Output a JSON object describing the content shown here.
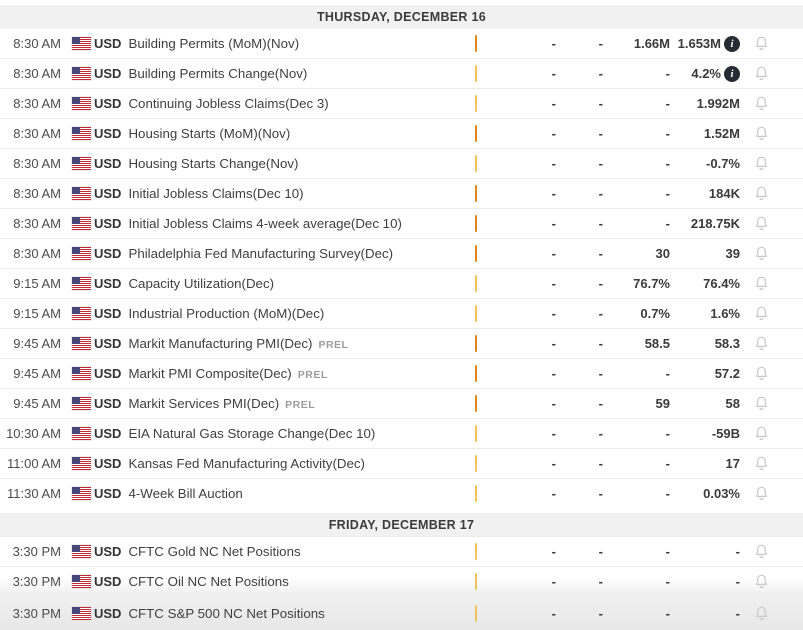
{
  "theme": {
    "impact_medium_color": "#E0861E",
    "impact_low_color": "#F5C963",
    "section_header_bg": "#F1F1F2",
    "info_icon_bg": "#272B33",
    "bell_icon_color": "#CBCBCB"
  },
  "columns": [
    "time",
    "currency",
    "event",
    "impact",
    "actual",
    "deviation",
    "consensus",
    "previous"
  ],
  "sections": [
    {
      "title": "THURSDAY, DECEMBER 16",
      "rows": [
        {
          "time": "8:30 AM",
          "currency": "USD",
          "flag": "us-flag",
          "event": "Building Permits (MoM)(Nov)",
          "suffix": "",
          "impact": "medium",
          "actual": "-",
          "deviation": "-",
          "consensus": "1.66M",
          "previous": "1.653M",
          "info": true
        },
        {
          "time": "8:30 AM",
          "currency": "USD",
          "flag": "us-flag",
          "event": "Building Permits Change(Nov)",
          "suffix": "",
          "impact": "low",
          "actual": "-",
          "deviation": "-",
          "consensus": "-",
          "previous": "4.2%",
          "info": true
        },
        {
          "time": "8:30 AM",
          "currency": "USD",
          "flag": "us-flag",
          "event": "Continuing Jobless Claims(Dec 3)",
          "suffix": "",
          "impact": "low",
          "actual": "-",
          "deviation": "-",
          "consensus": "-",
          "previous": "1.992M",
          "info": false
        },
        {
          "time": "8:30 AM",
          "currency": "USD",
          "flag": "us-flag",
          "event": "Housing Starts (MoM)(Nov)",
          "suffix": "",
          "impact": "medium",
          "actual": "-",
          "deviation": "-",
          "consensus": "-",
          "previous": "1.52M",
          "info": false
        },
        {
          "time": "8:30 AM",
          "currency": "USD",
          "flag": "us-flag",
          "event": "Housing Starts Change(Nov)",
          "suffix": "",
          "impact": "low",
          "actual": "-",
          "deviation": "-",
          "consensus": "-",
          "previous": "-0.7%",
          "info": false
        },
        {
          "time": "8:30 AM",
          "currency": "USD",
          "flag": "us-flag",
          "event": "Initial Jobless Claims(Dec 10)",
          "suffix": "",
          "impact": "medium",
          "actual": "-",
          "deviation": "-",
          "consensus": "-",
          "previous": "184K",
          "info": false
        },
        {
          "time": "8:30 AM",
          "currency": "USD",
          "flag": "us-flag",
          "event": "Initial Jobless Claims 4-week average(Dec 10)",
          "suffix": "",
          "impact": "medium",
          "actual": "-",
          "deviation": "-",
          "consensus": "-",
          "previous": "218.75K",
          "info": false
        },
        {
          "time": "8:30 AM",
          "currency": "USD",
          "flag": "us-flag",
          "event": "Philadelphia Fed Manufacturing Survey(Dec)",
          "suffix": "",
          "impact": "medium",
          "actual": "-",
          "deviation": "-",
          "consensus": "30",
          "previous": "39",
          "info": false
        },
        {
          "time": "9:15 AM",
          "currency": "USD",
          "flag": "us-flag",
          "event": "Capacity Utilization(Dec)",
          "suffix": "",
          "impact": "low",
          "actual": "-",
          "deviation": "-",
          "consensus": "76.7%",
          "previous": "76.4%",
          "info": false
        },
        {
          "time": "9:15 AM",
          "currency": "USD",
          "flag": "us-flag",
          "event": "Industrial Production (MoM)(Dec)",
          "suffix": "",
          "impact": "low",
          "actual": "-",
          "deviation": "-",
          "consensus": "0.7%",
          "previous": "1.6%",
          "info": false
        },
        {
          "time": "9:45 AM",
          "currency": "USD",
          "flag": "us-flag",
          "event": "Markit Manufacturing PMI(Dec)",
          "suffix": "PREL",
          "impact": "medium",
          "actual": "-",
          "deviation": "-",
          "consensus": "58.5",
          "previous": "58.3",
          "info": false
        },
        {
          "time": "9:45 AM",
          "currency": "USD",
          "flag": "us-flag",
          "event": "Markit PMI Composite(Dec)",
          "suffix": "PREL",
          "impact": "medium",
          "actual": "-",
          "deviation": "-",
          "consensus": "-",
          "previous": "57.2",
          "info": false
        },
        {
          "time": "9:45 AM",
          "currency": "USD",
          "flag": "us-flag",
          "event": "Markit Services PMI(Dec)",
          "suffix": "PREL",
          "impact": "medium",
          "actual": "-",
          "deviation": "-",
          "consensus": "59",
          "previous": "58",
          "info": false
        },
        {
          "time": "10:30 AM",
          "currency": "USD",
          "flag": "us-flag",
          "event": "EIA Natural Gas Storage Change(Dec 10)",
          "suffix": "",
          "impact": "low",
          "actual": "-",
          "deviation": "-",
          "consensus": "-",
          "previous": "-59B",
          "info": false
        },
        {
          "time": "11:00 AM",
          "currency": "USD",
          "flag": "us-flag",
          "event": "Kansas Fed Manufacturing Activity(Dec)",
          "suffix": "",
          "impact": "low",
          "actual": "-",
          "deviation": "-",
          "consensus": "-",
          "previous": "17",
          "info": false
        },
        {
          "time": "11:30 AM",
          "currency": "USD",
          "flag": "us-flag",
          "event": "4-Week Bill Auction",
          "suffix": "",
          "impact": "low",
          "actual": "-",
          "deviation": "-",
          "consensus": "-",
          "previous": "0.03%",
          "info": false
        }
      ]
    },
    {
      "title": "FRIDAY, DECEMBER 17",
      "rows": [
        {
          "time": "3:30 PM",
          "currency": "USD",
          "flag": "us-flag",
          "event": "CFTC Gold NC Net Positions",
          "suffix": "",
          "impact": "low",
          "actual": "-",
          "deviation": "-",
          "consensus": "-",
          "previous": "-",
          "info": false
        },
        {
          "time": "3:30 PM",
          "currency": "USD",
          "flag": "us-flag",
          "event": "CFTC Oil NC Net Positions",
          "suffix": "",
          "impact": "low",
          "actual": "-",
          "deviation": "-",
          "consensus": "-",
          "previous": "-",
          "info": false
        },
        {
          "time": "3:30 PM",
          "currency": "USD",
          "flag": "us-flag",
          "event": "CFTC S&P 500 NC Net Positions",
          "suffix": "",
          "impact": "low",
          "actual": "-",
          "deviation": "-",
          "consensus": "-",
          "previous": "-",
          "info": false
        }
      ]
    }
  ]
}
